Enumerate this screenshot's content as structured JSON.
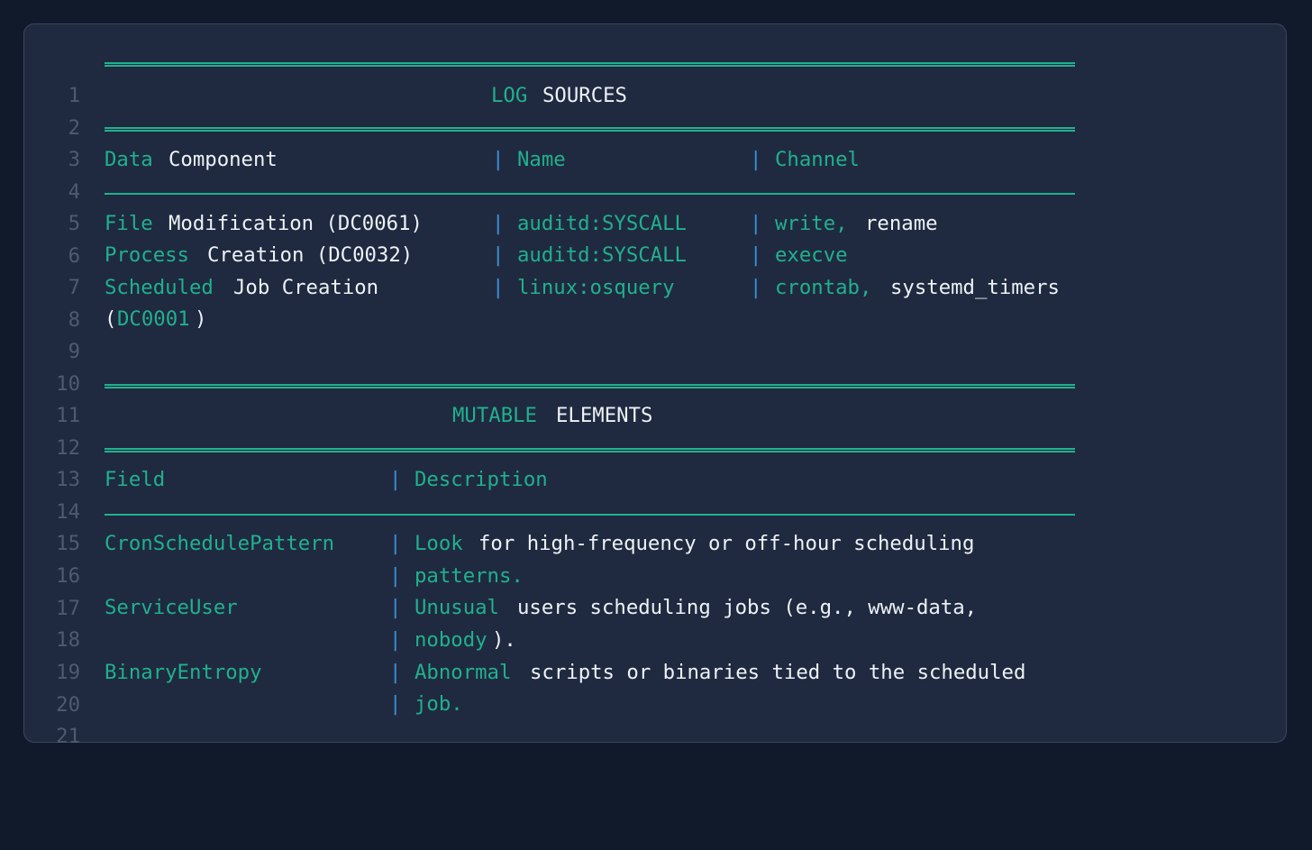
{
  "line_numbers": [
    "1",
    "2",
    "3",
    "4",
    "5",
    "6",
    "7",
    "8",
    "9",
    "10",
    "11",
    "12",
    "13",
    "14",
    "15",
    "16",
    "17",
    "18",
    "19",
    "20",
    "21"
  ],
  "log_sources": {
    "title_a": "LOG",
    "title_b": "SOURCES",
    "header": {
      "col1_a": "Data",
      "col1_b": "Component",
      "col2": "Name",
      "col3": "Channel"
    },
    "rows": [
      {
        "c1_a": "File",
        "c1_b": "Modification (DC0061)",
        "c2": "auditd:SYSCALL",
        "c3_a": "write,",
        "c3_b": "rename"
      },
      {
        "c1_a": "Process",
        "c1_b": "Creation (DC0032)",
        "c2": "auditd:SYSCALL",
        "c3_a": "execve",
        "c3_b": ""
      },
      {
        "c1_a": "Scheduled",
        "c1_b": "Job Creation",
        "c2": "linux:osquery",
        "c3_a": "crontab,",
        "c3_b": "systemd_timers"
      }
    ],
    "wrap_open": "(",
    "wrap_id": "DC0001",
    "wrap_close": ")"
  },
  "mutable_elements": {
    "title_a": "MUTABLE",
    "title_b": "ELEMENTS",
    "header": {
      "col1": "Field",
      "col2": "Description"
    },
    "rows": [
      {
        "field": "CronSchedulePattern",
        "d1_a": "Look",
        "d1_b": "for high-frequency or off-hour scheduling",
        "d2_a": "patterns.",
        "d2_b": ""
      },
      {
        "field": "ServiceUser",
        "d1_a": "Unusual",
        "d1_b": "users scheduling jobs (e.g., www-data,",
        "d2_a": "nobody",
        "d2_b": ")."
      },
      {
        "field": "BinaryEntropy",
        "d1_a": "Abnormal",
        "d1_b": "scripts or binaries tied to the scheduled",
        "d2_a": "job.",
        "d2_b": ""
      }
    ]
  },
  "separator": "|",
  "colors": {
    "page_background": "#111a2b",
    "panel_background": "#1f2a40",
    "accent_green": "#22b08e",
    "pipe_blue": "#3a8fd8",
    "text_white": "#eef2f7",
    "line_number_gray": "#4e5a72"
  }
}
